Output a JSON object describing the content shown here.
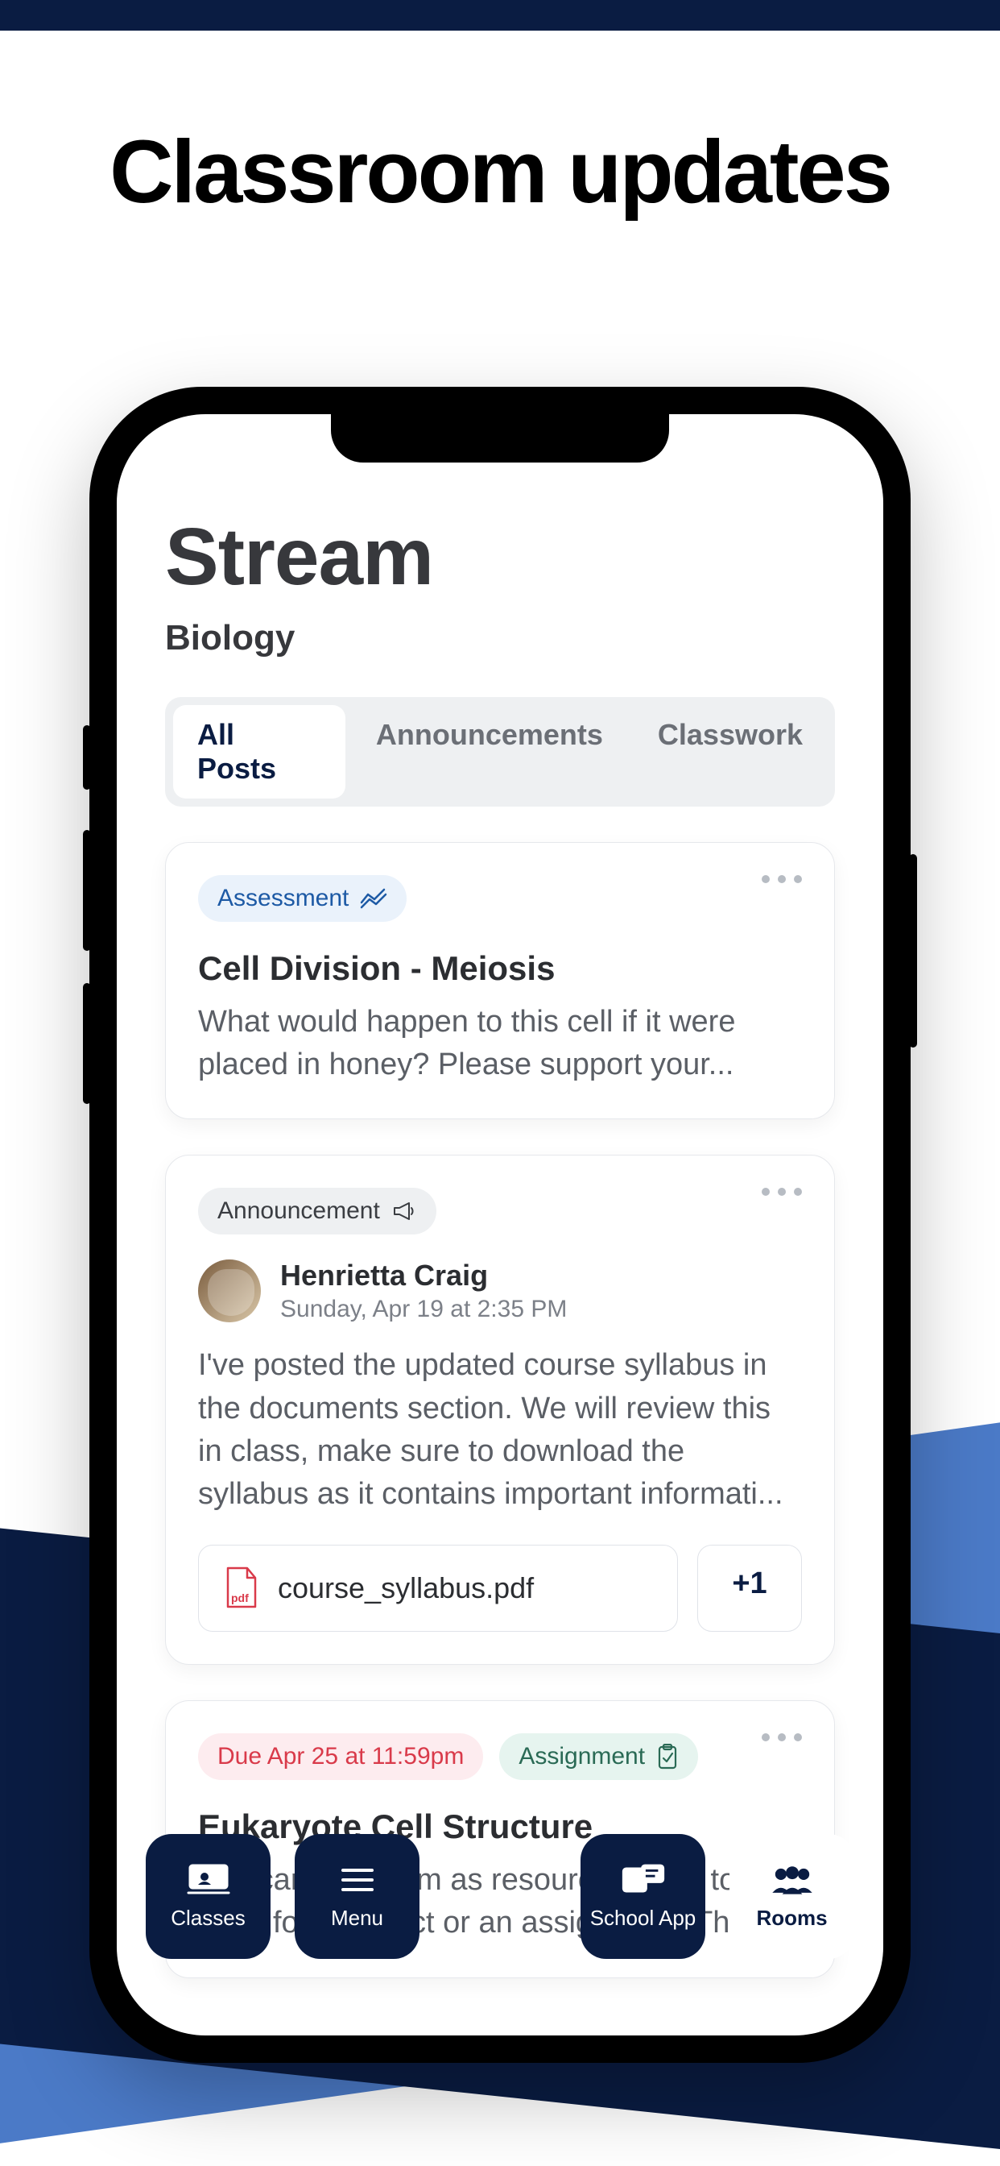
{
  "hero": {
    "title": "Classroom updates"
  },
  "stream": {
    "title": "Stream",
    "course": "Biology",
    "tabs": [
      {
        "label": "All Posts",
        "active": true
      },
      {
        "label": "Announcements",
        "active": false
      },
      {
        "label": "Classwork",
        "active": false
      }
    ]
  },
  "posts": [
    {
      "tag": "Assessment",
      "title": "Cell Division - Meiosis",
      "body": "What would happen to this cell if it were placed in honey? Please support your..."
    },
    {
      "tag": "Announcement",
      "author": {
        "name": "Henrietta Craig",
        "date": "Sunday, Apr 19 at 2:35 PM"
      },
      "body": "I've posted the updated course syllabus in the documents section. We will review this in class, make sure to download the syllabus as it contains important informati...",
      "attachment": {
        "filename": "course_syllabus.pdf",
        "extra": "+1"
      }
    },
    {
      "due": "Due Apr 25 at 11:59pm",
      "tag": "Assignment",
      "title": "Eukaryote Cell Structure",
      "body": "You can use them as resources to go to for help, for a project or an assignment. The"
    }
  ],
  "nav": {
    "classes": "Classes",
    "menu": "Menu",
    "schoolapp": "School App",
    "rooms": "Rooms"
  },
  "icons": {
    "pdf_label": "pdf"
  }
}
